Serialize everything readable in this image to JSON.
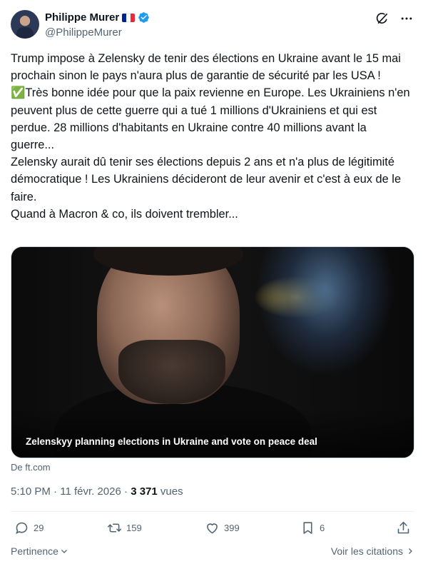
{
  "author": {
    "name": "Philippe Murer",
    "handle": "@PhilippeMurer",
    "flag_colors": [
      "#002395",
      "#ffffff",
      "#ed2939"
    ]
  },
  "header_icons": [
    "grok-icon",
    "more-icon"
  ],
  "tweet": {
    "text": "Trump impose à Zelensky de tenir des élections en Ukraine avant le 15 mai prochain sinon le pays n'aura plus de garantie de sécurité par les USA !\n✅Très bonne idée pour que la paix revienne en Europe. Les Ukrainiens n'en peuvent plus de cette guerre qui a tué 1 millions d'Ukrainiens et qui est perdue. 28 millions d'habitants en Ukraine contre 40 millions avant la guerre...\nZelensky aurait dû tenir ses élections depuis 2 ans et n'a plus de légitimité démocratique ! Les Ukrainiens décideront de leur avenir et c'est à eux de le faire.\nQuand à Macron & co, ils doivent trembler..."
  },
  "media": {
    "caption": "Zelenskyy planning elections in Ukraine and vote on peace deal",
    "source": "De ft.com"
  },
  "meta": {
    "time": "5:10 PM",
    "date": "11 févr. 2026",
    "views_count": "3 371",
    "views_label": "vues"
  },
  "actions": {
    "replies": "29",
    "reposts": "159",
    "likes": "399",
    "bookmarks": "6"
  },
  "footer": {
    "relevance": "Pertinence",
    "quotes": "Voir les citations"
  },
  "colors": {
    "verified": "#1d9bf0",
    "text_secondary": "#536471",
    "text_primary": "#0f1419"
  }
}
